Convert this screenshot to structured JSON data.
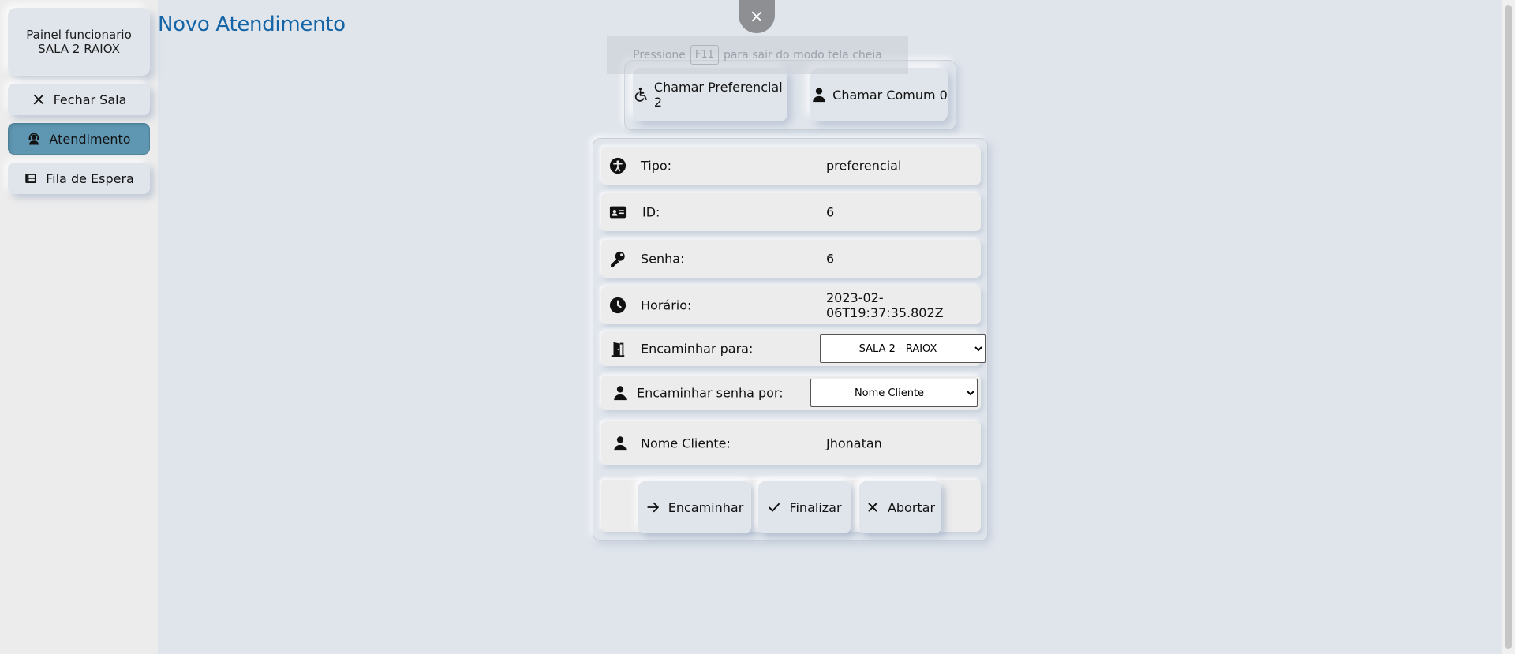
{
  "sidebar": {
    "title_line1": "Painel funcionario",
    "title_line2": "SALA 2 RAIOX",
    "items": [
      {
        "label": "Fechar Sala",
        "icon": "close-icon"
      },
      {
        "label": "Atendimento",
        "icon": "headset-user-icon",
        "active": true
      },
      {
        "label": "Fila de Espera",
        "icon": "queue-list-icon"
      }
    ]
  },
  "page": {
    "title": "Novo Atendimento"
  },
  "fullscreen_hint": {
    "before": "Pressione",
    "key": "F11",
    "after": "para sair do modo tela cheia"
  },
  "call_buttons": {
    "preferencial_label": "Chamar Preferencial 2",
    "comum_label": "Chamar Comum 0"
  },
  "details": {
    "tipo_label": "Tipo:",
    "tipo_value": "preferencial",
    "id_label": "ID:",
    "id_value": "6",
    "senha_label": "Senha:",
    "senha_value": "6",
    "horario_label": "Horário:",
    "horario_value": "2023-02-06T19:37:35.802Z",
    "encaminhar_para_label": "Encaminhar para:",
    "encaminhar_para_selected": "SALA 2 - RAIOX",
    "encaminhar_senha_label": "Encaminhar senha por:",
    "encaminhar_senha_selected": "Nome Cliente",
    "nome_cliente_label": "Nome Cliente:",
    "nome_cliente_value": "Jhonatan"
  },
  "actions": {
    "encaminhar_label": "Encaminhar",
    "finalizar_label": "Finalizar",
    "abortar_label": "Abortar"
  },
  "colors": {
    "background": "#e0e5ec",
    "accent_title": "#1565a6",
    "active_item": "#5f97b2"
  }
}
